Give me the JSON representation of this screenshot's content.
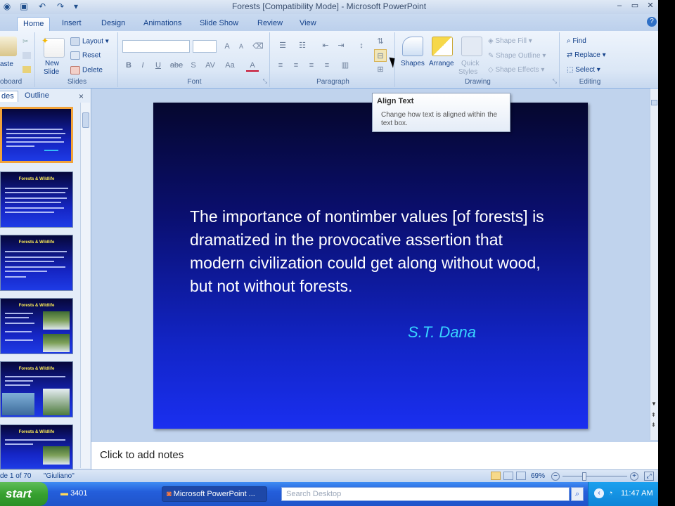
{
  "window": {
    "title": "Forests [Compatibility Mode] - Microsoft PowerPoint",
    "controls": [
      "–",
      "▭",
      "✕"
    ]
  },
  "ribbon_tabs": [
    {
      "label": "Home",
      "active": true
    },
    {
      "label": "Insert"
    },
    {
      "label": "Design"
    },
    {
      "label": "Animations"
    },
    {
      "label": "Slide Show"
    },
    {
      "label": "Review"
    },
    {
      "label": "View"
    }
  ],
  "ribbon": {
    "clipboard": {
      "label": "oboard",
      "paste": "aste"
    },
    "slides": {
      "label": "Slides",
      "new_slide_1": "New",
      "new_slide_2": "Slide",
      "layout": "Layout",
      "reset": "Reset",
      "delete": "Delete"
    },
    "font": {
      "label": "Font",
      "font_name": "",
      "font_size": "",
      "buttons": [
        "B",
        "I",
        "U",
        "abe",
        "S",
        "AV",
        "Aa",
        "A"
      ]
    },
    "paragraph": {
      "label": "Paragraph"
    },
    "drawing": {
      "label": "Drawing",
      "shapes": "Shapes",
      "arrange": "Arrange",
      "quick_styles_1": "Quick",
      "quick_styles_2": "Styles",
      "shape_fill": "Shape Fill",
      "shape_outline": "Shape Outline",
      "shape_effects": "Shape Effects"
    },
    "editing": {
      "label": "Editing",
      "find": "Find",
      "replace": "Replace",
      "select": "Select"
    }
  },
  "tooltip": {
    "title": "Align Text",
    "body": "Change how text is aligned within the text box."
  },
  "left_pane": {
    "tabs": [
      {
        "label": "des",
        "active": true
      },
      {
        "label": "Outline"
      }
    ],
    "close": "×",
    "thumbnails": [
      {
        "title": "",
        "selected": true
      },
      {
        "title": "Forests & Wildlife"
      },
      {
        "title": "Forests & Wildlife"
      },
      {
        "title": "Forests & Wildlife"
      },
      {
        "title": "Forests & Wildlife"
      },
      {
        "title": "Forests & Wildlife"
      }
    ]
  },
  "slide": {
    "quote": "The importance of nontimber values [of forests] is dramatized in the provocative assertion that modern civilization could get along without wood, but not without forests.",
    "author": "S.T. Dana"
  },
  "notes": {
    "placeholder": "Click to add notes"
  },
  "status_bar": {
    "slide_info": "de 1 of 70",
    "theme": "\"Giuliano\"",
    "zoom": "69%"
  },
  "taskbar": {
    "start": "start",
    "tasks": [
      {
        "label": "3401"
      },
      {
        "label": "Microsoft PowerPoint ...",
        "active": true
      }
    ],
    "search_placeholder": "Search Desktop",
    "clock": "11:47 AM"
  },
  "colors": {
    "slide_text": "#ffffff",
    "slide_author": "#38d5ff",
    "thumb_selected_border": "#f2a33a",
    "start_button": "#37a12f",
    "taskbar": "#245edb"
  }
}
